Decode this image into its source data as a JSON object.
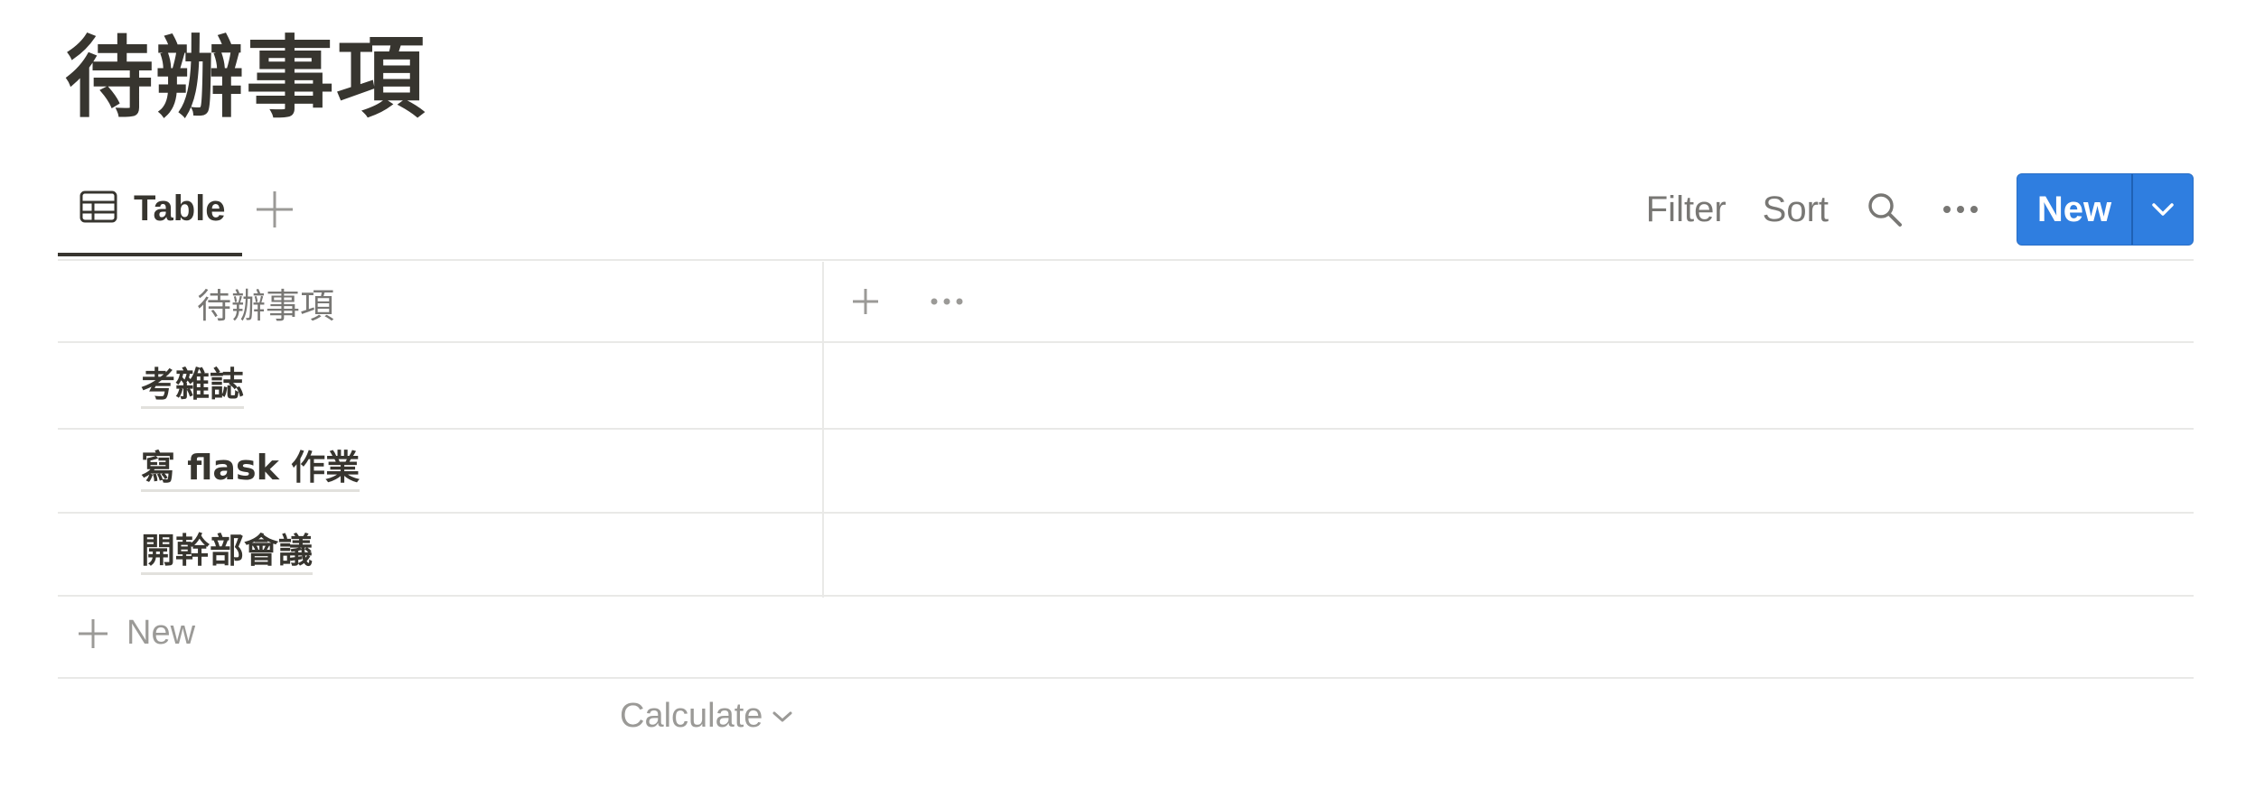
{
  "page": {
    "title": "待辦事項"
  },
  "view": {
    "tab_label": "Table"
  },
  "toolbar": {
    "filter_label": "Filter",
    "sort_label": "Sort",
    "new_label": "New"
  },
  "table": {
    "column_header": "待辦事項",
    "rows": [
      {
        "title": "考雜誌"
      },
      {
        "title": "寫 flask 作業"
      },
      {
        "title": "開幹部會議"
      }
    ],
    "new_row_label": "New",
    "calculate_label": "Calculate"
  },
  "colors": {
    "accent": "#2f7ee0",
    "text": "#37352f",
    "muted": "#787774",
    "border": "#e9e9e7"
  },
  "icons": [
    "table-icon",
    "plus-icon",
    "search-icon",
    "more-icon",
    "chevron-down-icon"
  ]
}
